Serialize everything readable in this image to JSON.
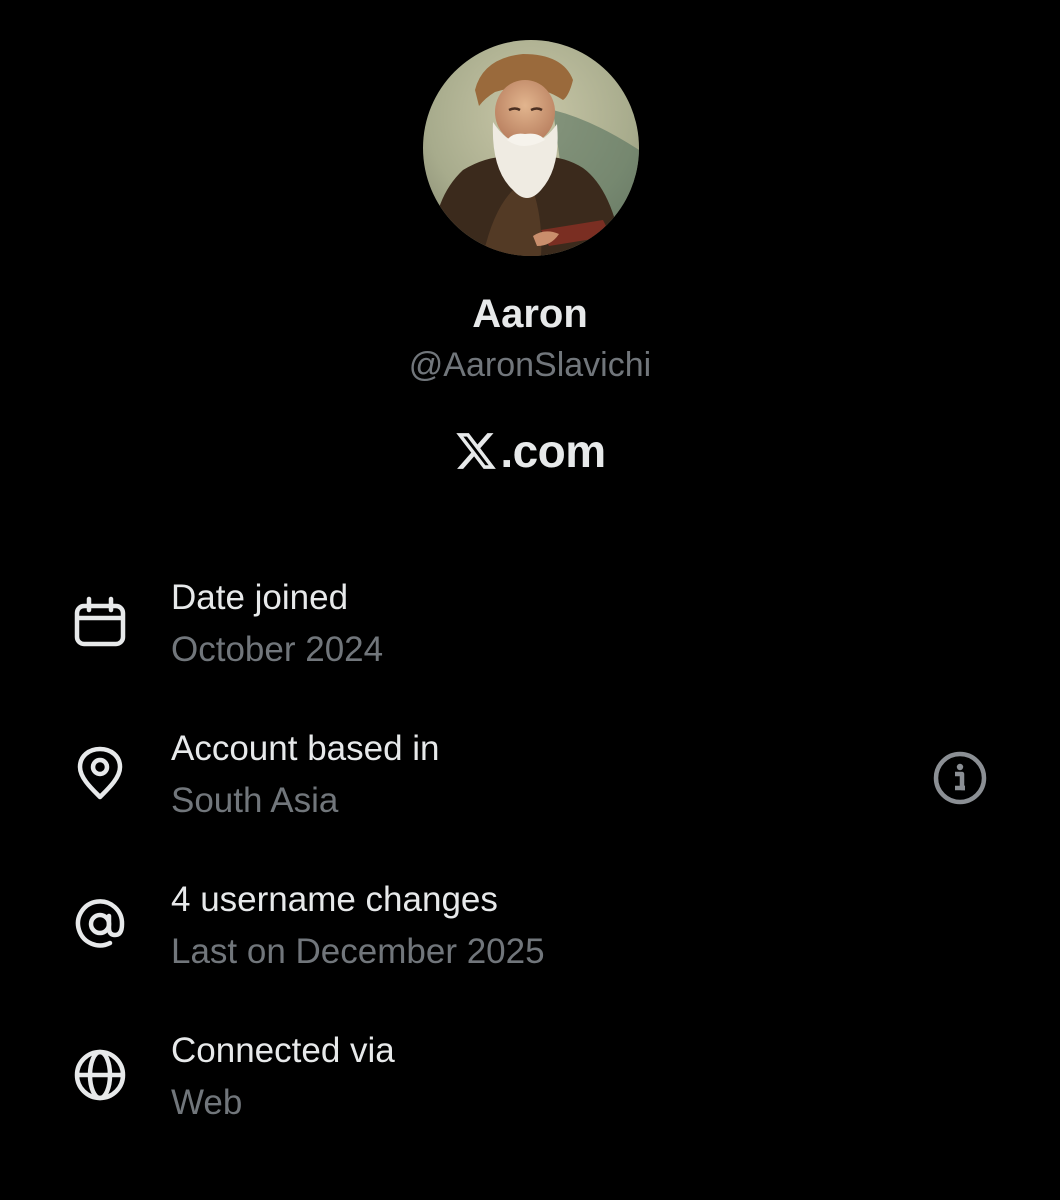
{
  "profile": {
    "display_name": "Aaron",
    "handle": "@AaronSlavichi",
    "brand_text": ".com"
  },
  "details": [
    {
      "icon": "calendar-icon",
      "label": "Date joined",
      "value": "October 2024"
    },
    {
      "icon": "location-pin-icon",
      "label": "Account based in",
      "value": "South Asia"
    },
    {
      "icon": "at-sign-icon",
      "label": "4 username changes",
      "value": "Last on December 2025"
    },
    {
      "icon": "globe-icon",
      "label": "Connected via",
      "value": "Web"
    }
  ],
  "colors": {
    "background": "#000000",
    "primary_text": "#e7e9ea",
    "secondary_text": "#71767b"
  }
}
